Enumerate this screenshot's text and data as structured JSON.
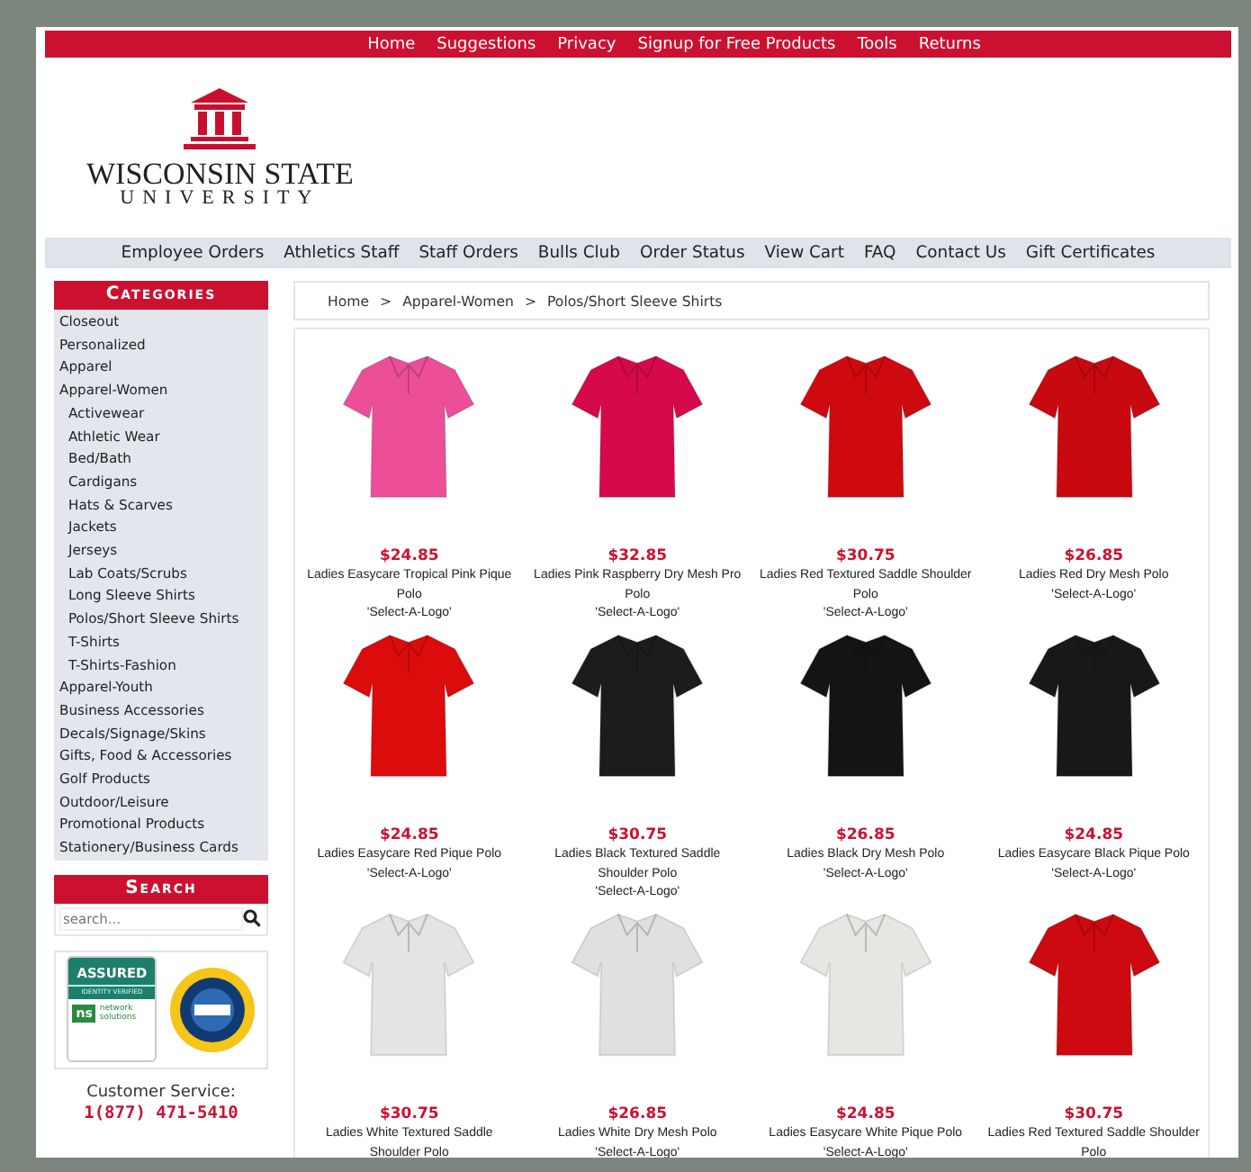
{
  "top_nav": [
    "Home",
    "Suggestions",
    "Privacy",
    "Signup for Free Products",
    "Tools",
    "Returns"
  ],
  "logo": {
    "name": "WISCONSIN STATE",
    "subtitle": "UNIVERSITY"
  },
  "main_nav": [
    "Employee Orders",
    "Athletics Staff",
    "Staff Orders",
    "Bulls Club",
    "Order Status",
    "View Cart",
    "FAQ",
    "Contact Us",
    "Gift Certificates"
  ],
  "sidebar": {
    "categories_title": "Categories",
    "categories": [
      {
        "label": "Closeout"
      },
      {
        "label": "Personalized"
      },
      {
        "label": "Apparel"
      },
      {
        "label": "Apparel-Women",
        "children": [
          {
            "label": "Activewear"
          },
          {
            "label": "Athletic Wear"
          },
          {
            "label": "Bed/Bath"
          },
          {
            "label": "Cardigans"
          },
          {
            "label": "Hats & Scarves"
          },
          {
            "label": "Jackets"
          },
          {
            "label": "Jerseys"
          },
          {
            "label": "Lab Coats/Scrubs"
          },
          {
            "label": "Long Sleeve Shirts"
          },
          {
            "label": "Polos/Short Sleeve Shirts"
          },
          {
            "label": "T-Shirts"
          },
          {
            "label": "T-Shirts-Fashion"
          }
        ]
      },
      {
        "label": "Apparel-Youth"
      },
      {
        "label": "Business Accessories"
      },
      {
        "label": "Decals/Signage/Skins"
      },
      {
        "label": "Gifts, Food & Accessories"
      },
      {
        "label": "Golf Products"
      },
      {
        "label": "Outdoor/Leisure"
      },
      {
        "label": "Promotional Products"
      },
      {
        "label": "Stationery/Business Cards"
      }
    ],
    "search_title": "Search",
    "search": {
      "placeholder": "search..."
    },
    "seal": {
      "title": "ASSURED",
      "subtitle": "IDENTITY VERIFIED",
      "brand_initials": "ns",
      "brand": "network solutions"
    },
    "customer_service": {
      "label": "Customer Service:",
      "phone": "1(877) 471-5410"
    }
  },
  "breadcrumb": [
    "Home",
    "Apparel-Women",
    "Polos/Short Sleeve Shirts"
  ],
  "breadcrumb_separator": ">",
  "products": [
    {
      "price": "$24.85",
      "name": "Ladies Easycare Tropical Pink Pique Polo",
      "note": "'Select-A-Logo'",
      "color": "#ec4f98"
    },
    {
      "price": "$32.85",
      "name": "Ladies Pink Raspberry Dry Mesh Pro Polo",
      "note": "'Select-A-Logo'",
      "color": "#d6094a"
    },
    {
      "price": "$30.75",
      "name": "Ladies Red Textured Saddle Shoulder Polo",
      "note": "'Select-A-Logo'",
      "color": "#cf0a0e"
    },
    {
      "price": "$26.85",
      "name": "Ladies Red Dry Mesh Polo",
      "note": "'Select-A-Logo'",
      "color": "#c80a10"
    },
    {
      "price": "$24.85",
      "name": "Ladies Easycare Red Pique Polo",
      "note": "'Select-A-Logo'",
      "color": "#dc0c0c"
    },
    {
      "price": "$30.75",
      "name": "Ladies Black Textured Saddle Shoulder Polo",
      "note": "'Select-A-Logo'",
      "color": "#1c1c1c"
    },
    {
      "price": "$26.85",
      "name": "Ladies Black Dry Mesh Polo",
      "note": "'Select-A-Logo'",
      "color": "#141414"
    },
    {
      "price": "$24.85",
      "name": "Ladies Easycare Black Pique Polo",
      "note": "'Select-A-Logo'",
      "color": "#181818"
    },
    {
      "price": "$30.75",
      "name": "Ladies White Textured Saddle Shoulder Polo",
      "color": "#e4e4e4"
    },
    {
      "price": "$26.85",
      "name": "Ladies White Dry Mesh Polo",
      "note": "'Select-A-Logo'",
      "color": "#e0e0e0"
    },
    {
      "price": "$24.85",
      "name": "Ladies Easycare White Pique Polo",
      "note": "'Select-A-Logo'",
      "color": "#e6e6e2"
    },
    {
      "price": "$30.75",
      "name": "Ladies Red Textured Saddle Shoulder Polo",
      "color": "#cc0a10"
    }
  ]
}
